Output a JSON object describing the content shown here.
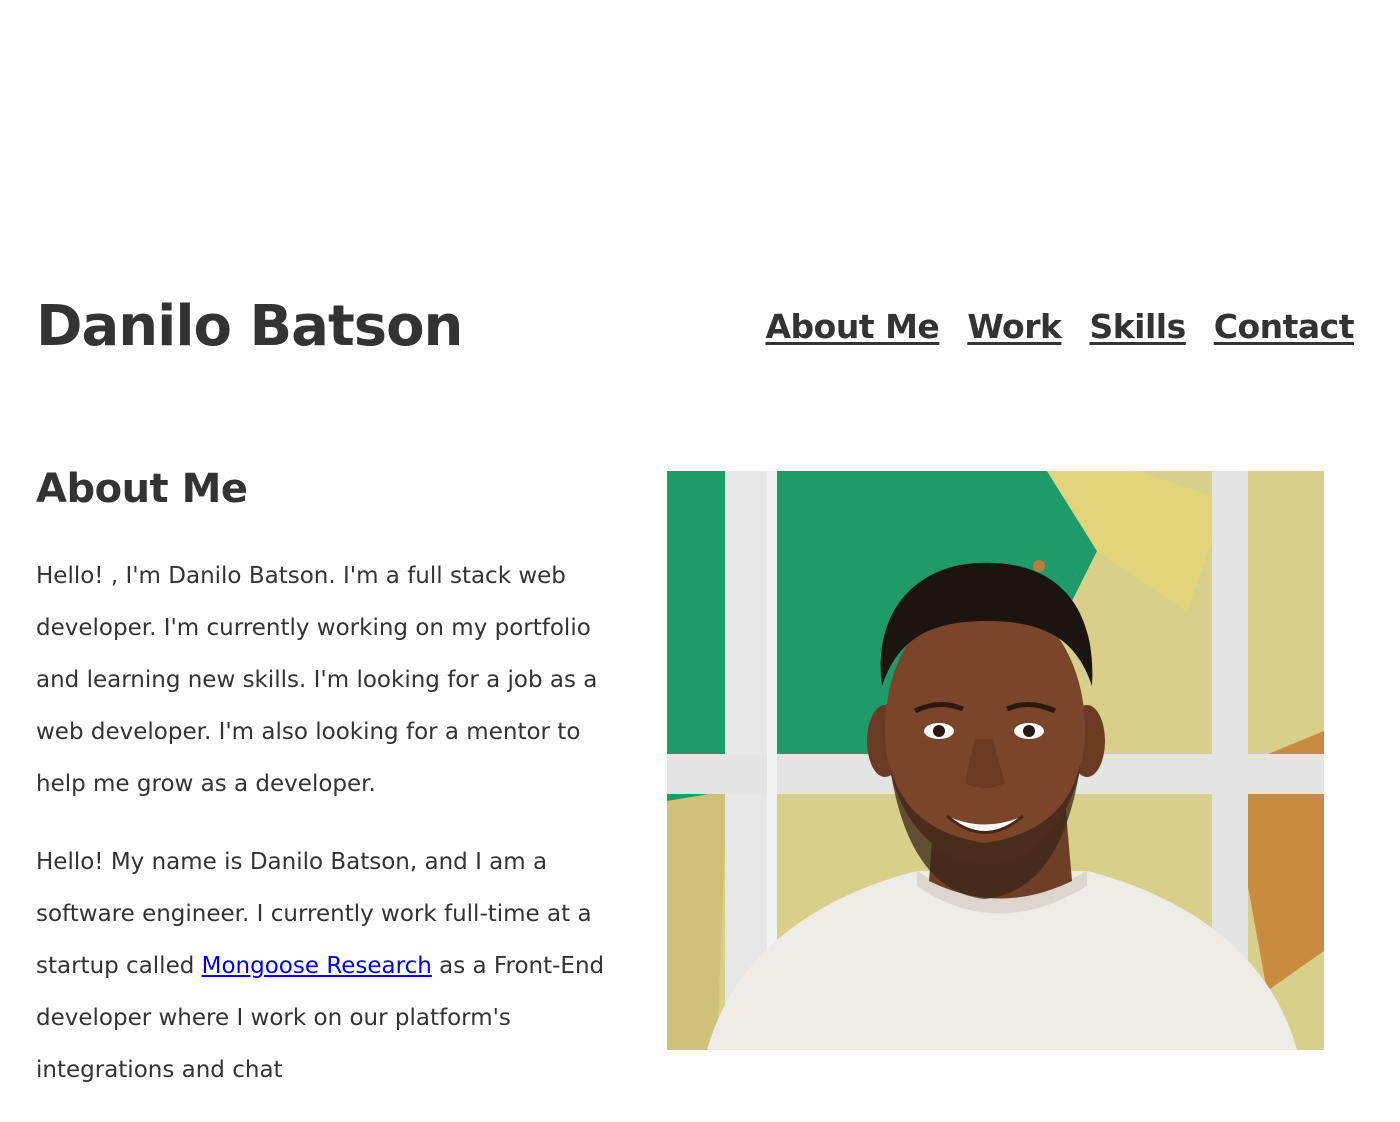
{
  "header": {
    "name": "Danilo Batson",
    "nav": [
      {
        "label": "About Me"
      },
      {
        "label": "Work"
      },
      {
        "label": "Skills"
      },
      {
        "label": "Contact"
      }
    ]
  },
  "about": {
    "heading": "About Me",
    "paragraph1": "Hello! , I'm Danilo Batson. I'm a full stack web developer. I'm currently working on my portfolio and learning new skills. I'm looking for a job as a web developer. I'm also looking for a mentor to help me grow as a developer.",
    "paragraph2_before": "Hello! My name is Danilo Batson, and I am a software engineer. I currently work full-time at a startup called ",
    "paragraph2_link": "Mongoose Research",
    "paragraph2_after": " as a Front-End developer where I work on our platform's integrations and chat"
  },
  "colors": {
    "text": "#333333",
    "link": "#0000ee",
    "background": "#ffffff"
  }
}
